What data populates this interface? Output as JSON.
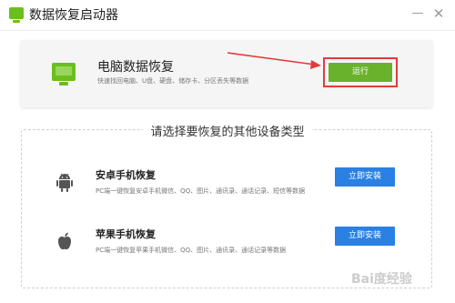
{
  "window": {
    "title": "数据恢复启动器",
    "minimize_symbol": "—",
    "close_symbol": "✕"
  },
  "pc_recovery": {
    "title": "电脑数据恢复",
    "description": "快速找回电脑、U盘、硬盘、储存卡、分区丢失等数据",
    "run_label": "运行",
    "icon": "monitor-icon"
  },
  "other_devices": {
    "section_title": "请选择要恢复的其他设备类型",
    "items": [
      {
        "title": "安卓手机恢复",
        "description": "PC端一键恢复安卓手机微信、QQ、图片、通讯录、通话记录、短信等数据",
        "install_label": "立即安装",
        "icon": "android-icon"
      },
      {
        "title": "苹果手机恢复",
        "description": "PC端一键恢复苹果手机微信、QQ、图片、通讯录、通话记录等数据",
        "install_label": "立即安装",
        "icon": "apple-icon"
      }
    ]
  },
  "watermark": {
    "text": "Bai度经验"
  },
  "colors": {
    "accent_green": "#69b22c",
    "install_blue": "#2a80e3",
    "highlight_red": "#e23b3b"
  }
}
